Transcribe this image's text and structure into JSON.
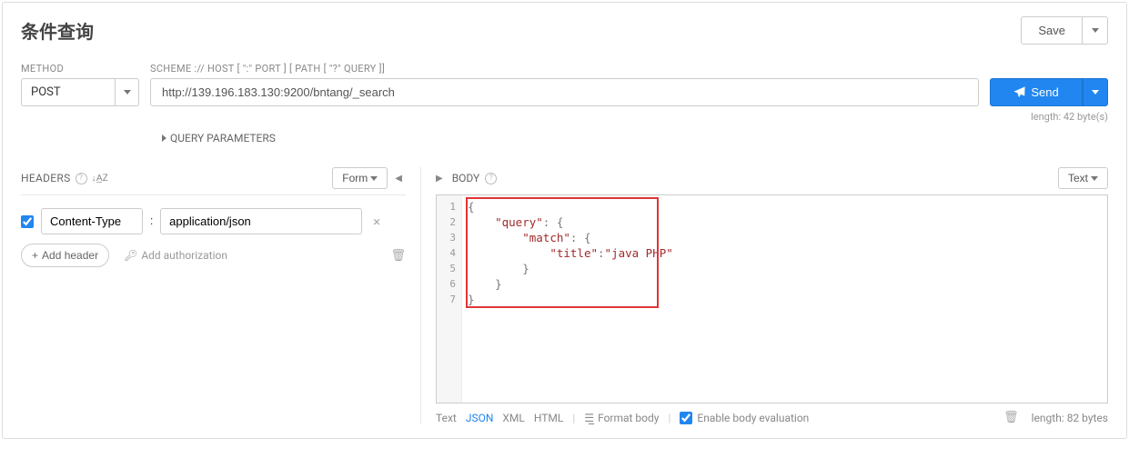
{
  "title": "条件查询",
  "save": {
    "label": "Save"
  },
  "labels": {
    "method": "METHOD",
    "scheme": "SCHEME :// HOST [ \":\" PORT ] [ PATH [ \"?\" QUERY ]]"
  },
  "method": "POST",
  "url": "http://139.196.183.130:9200/bntang/_search",
  "send": "Send",
  "url_length": "length: 42 byte(s)",
  "query_params": "QUERY PARAMETERS",
  "headers": {
    "title": "HEADERS",
    "form_btn": "Form",
    "items": [
      {
        "enabled": true,
        "name": "Content-Type",
        "value": "application/json"
      }
    ],
    "add": "Add header",
    "add_auth": "Add authorization"
  },
  "body": {
    "title": "BODY",
    "view_btn": "Text",
    "line_numbers": [
      "1",
      "2",
      "3",
      "4",
      "5",
      "6",
      "7"
    ],
    "code_html": "<span class=\"brace\">{</span>\n    <span class=\"key\">\"query\"</span><span class=\"punc\">: {</span>\n        <span class=\"key\">\"match\"</span><span class=\"punc\">: {</span>\n            <span class=\"key\">\"title\"</span><span class=\"punc\">:</span><span class=\"str\">\"java PHP\"</span>\n        <span class=\"punc\">}</span>\n    <span class=\"punc\">}</span>\n<span class=\"brace\">}</span>",
    "footer": {
      "modes": {
        "text": "Text",
        "json": "JSON",
        "xml": "XML",
        "html": "HTML"
      },
      "format": "Format body",
      "enable_eval": "Enable body evaluation",
      "length": "length: 82 bytes"
    }
  },
  "colors": {
    "accent": "#2186f0"
  }
}
